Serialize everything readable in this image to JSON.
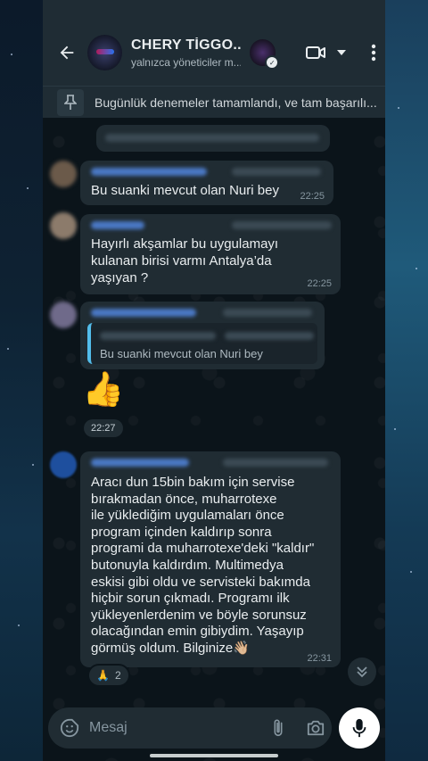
{
  "header": {
    "title": "CHERY TİGGO...",
    "subtitle": "yalnızca yöneticiler m..."
  },
  "pinned": {
    "text": "Bugünlük denemeler tamamlandı, ve tam başarılı..."
  },
  "messages": [
    {
      "text": "Bu suanki mevcut olan Nuri bey",
      "time": "22:25"
    },
    {
      "text": "Hayırlı akşamlar bu uygulamayı kulanan birisi varmı Antalya’da yaşıyan ?",
      "time": "22:25"
    },
    {
      "quote": "Bu suanki mevcut olan Nuri bey"
    },
    {
      "emoji": "👍",
      "time": "22:27"
    },
    {
      "lines": [
        "Aracı dun 15bin bakım için servise",
        "bırakmadan önce, muharrotexe",
        "ile yüklediğim uygulamaları önce",
        "program içinden kaldırıp sonra",
        "programi da muharrotexe'deki \"kaldır\"",
        "butonuyla kaldırdım. Multimedya",
        "eskisi gibi oldu ve servisteki bakımda",
        "hiçbir sorun çıkmadı. Programı ilk",
        "yükleyenlerdenim ve böyle sorunsuz",
        "olacağından emin gibiydim. Yaşayıp",
        "görmüş oldum. Bilginize👋🏼"
      ],
      "time": "22:31",
      "reaction": {
        "emoji": "🙏",
        "count": "2"
      }
    }
  ],
  "composer": {
    "placeholder": "Mesaj"
  },
  "colors": {
    "header_bg": "#1f2c34",
    "bubble_bg": "#202c33",
    "chat_bg": "#0b141a",
    "accent": "#00a884",
    "quote_bar": "#53bdeb"
  },
  "icons": [
    "back-arrow-icon",
    "video-call-icon",
    "chevron-down-icon",
    "more-vert-icon",
    "pin-icon",
    "emoji-icon",
    "attach-icon",
    "camera-icon",
    "mic-icon",
    "double-chevron-down-icon"
  ]
}
